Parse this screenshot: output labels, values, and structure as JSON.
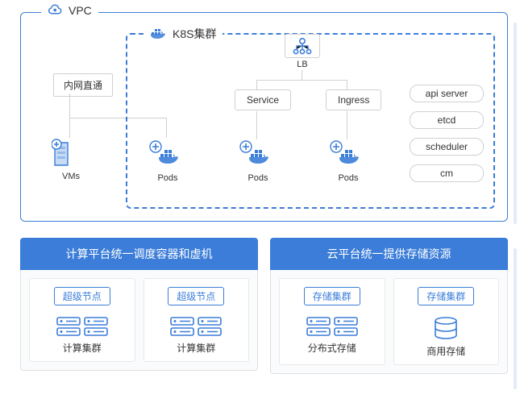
{
  "vpc": {
    "label": "VPC"
  },
  "nat": {
    "label": "内网直通"
  },
  "k8s": {
    "label": "K8S集群"
  },
  "lb": {
    "label": "LB"
  },
  "service": {
    "label": "Service"
  },
  "ingress": {
    "label": "Ingress"
  },
  "pods": {
    "vm": "VMs",
    "p1": "Pods",
    "p2": "Pods",
    "p3": "Pods"
  },
  "api": {
    "a": "api server",
    "b": "etcd",
    "c": "scheduler",
    "d": "cm"
  },
  "groups": {
    "g1": {
      "header": "计算平台统一调度容器和虚机",
      "c1": {
        "tag": "超级节点",
        "foot": "计算集群"
      },
      "c2": {
        "tag": "超级节点",
        "foot": "计算集群"
      }
    },
    "g2": {
      "header": "云平台统一提供存储资源",
      "c1": {
        "tag": "存储集群",
        "foot": "分布式存储"
      },
      "c2": {
        "tag": "存储集群",
        "foot": "商用存储"
      }
    }
  },
  "colors": {
    "primary": "#3b7dd8"
  }
}
